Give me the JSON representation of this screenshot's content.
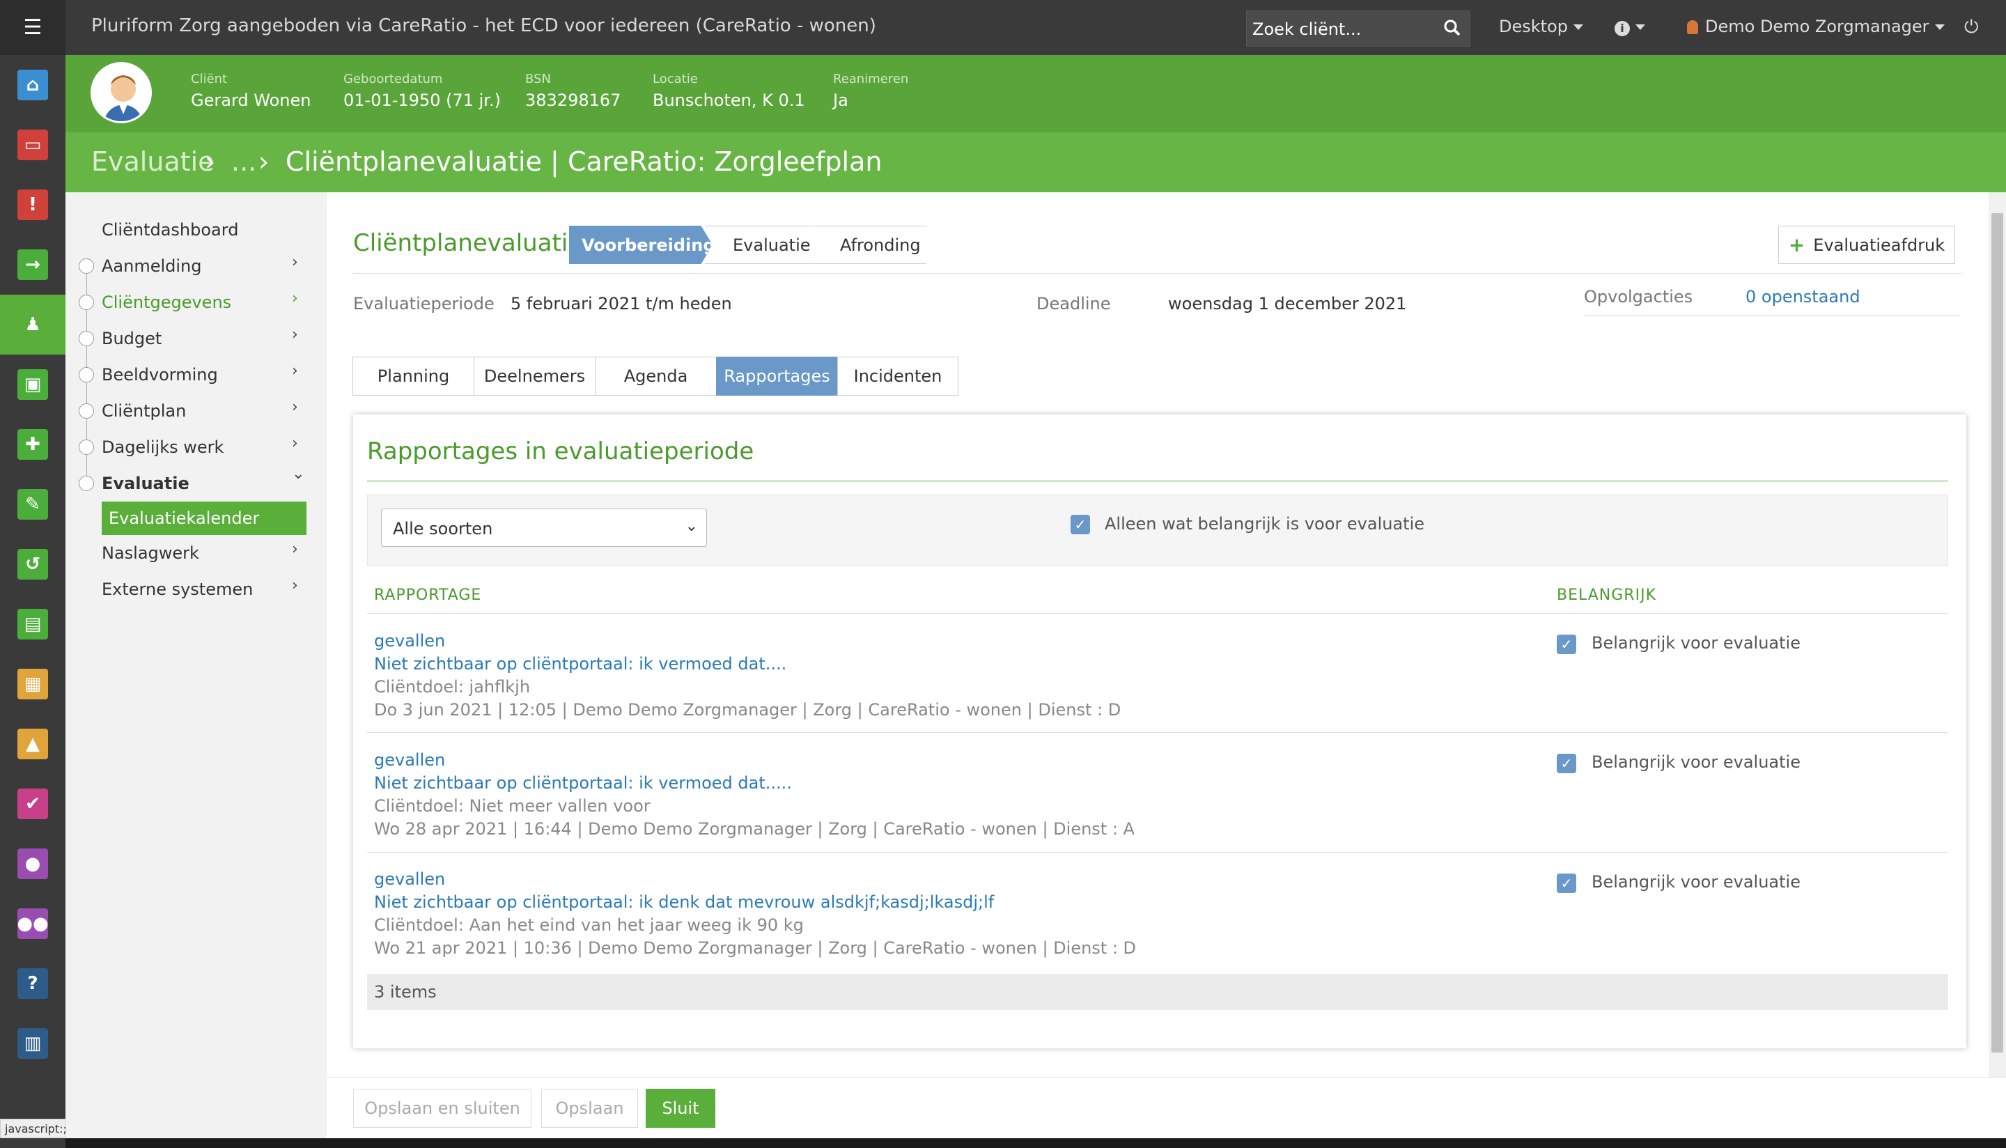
{
  "app": {
    "title": "Pluriform Zorg aangeboden via CareRatio - het ECD voor iedereen  (CareRatio - wonen)",
    "search_placeholder": "Zoek cliënt...",
    "desktop_label": "Desktop",
    "user_label": "Demo Demo Zorgmanager"
  },
  "client": {
    "fields": [
      {
        "label": "Cliënt",
        "value": "Gerard Wonen"
      },
      {
        "label": "Geboortedatum",
        "value": "01-01-1950 (71 jr.)"
      },
      {
        "label": "BSN",
        "value": "383298167"
      },
      {
        "label": "Locatie",
        "value": "Bunschoten, K 0.1"
      },
      {
        "label": "Reanimeren",
        "value": "Ja"
      }
    ]
  },
  "breadcrumb": {
    "root": "Evaluatie",
    "sep1": "›",
    "ellipsis": "...",
    "sep2": "›",
    "current": "Cliëntplanevaluatie | CareRatio: Zorgleefplan"
  },
  "sidebar": {
    "items": [
      {
        "label": "Cliëntdashboard"
      },
      {
        "label": "Aanmelding",
        "chevron": "›"
      },
      {
        "label": "Cliëntgegevens",
        "chevron": "›"
      },
      {
        "label": "Budget",
        "chevron": "›"
      },
      {
        "label": "Beeldvorming",
        "chevron": "›"
      },
      {
        "label": "Cliëntplan",
        "chevron": "›"
      },
      {
        "label": "Dagelijks werk",
        "chevron": "›"
      },
      {
        "label": "Evaluatie",
        "chevron": "⌄"
      },
      {
        "label": "Evaluatiekalender"
      },
      {
        "label": "Naslagwerk",
        "chevron": "›"
      },
      {
        "label": "Externe systemen",
        "chevron": "›"
      }
    ]
  },
  "wizard": {
    "title": "Cliëntplanevaluatie",
    "steps": [
      "Voorbereiding",
      "Evaluatie",
      "Afronding"
    ],
    "print_button": "Evaluatieafdruk"
  },
  "meta": {
    "period_label": "Evaluatieperiode",
    "period_value": "5 februari 2021 t/m heden",
    "deadline_label": "Deadline",
    "deadline_value": "woensdag 1 december 2021",
    "followup_label": "Opvolgacties",
    "followup_value": "0 openstaand"
  },
  "tabs": [
    "Planning",
    "Deelnemers",
    "Agenda",
    "Rapportages",
    "Incidenten"
  ],
  "reports": {
    "title": "Rapportages in evaluatieperiode",
    "filter_select": "Alle soorten",
    "filter_checkbox": "Alleen wat belangrijk is voor evaluatie",
    "col_report": "RAPPORTAGE",
    "col_important": "BELANGRIJK",
    "rows": [
      {
        "type": "gevallen",
        "text": "Niet zichtbaar op cliëntportaal: ik vermoed dat....",
        "goal": "Cliëntdoel: jahflkjh",
        "meta": "Do 3 jun 2021 | 12:05 | Demo Demo Zorgmanager | Zorg | CareRatio - wonen | Dienst : D",
        "important": "Belangrijk voor evaluatie"
      },
      {
        "type": "gevallen",
        "text": "Niet zichtbaar op cliëntportaal: ik vermoed dat.....",
        "goal": "Cliëntdoel: Niet meer vallen voor",
        "meta": "Wo 28 apr 2021 | 16:44 | Demo Demo Zorgmanager | Zorg | CareRatio - wonen | Dienst : A",
        "important": "Belangrijk voor evaluatie"
      },
      {
        "type": "gevallen",
        "text": "Niet zichtbaar op cliëntportaal: ik denk dat mevrouw alsdkjf;kasdj;lkasdj;lf",
        "goal": "Cliëntdoel: Aan het eind van het jaar weeg ik 90 kg",
        "meta": "Wo 21 apr 2021 | 10:36 | Demo Demo Zorgmanager | Zorg | CareRatio - wonen | Dienst : D",
        "important": "Belangrijk voor evaluatie"
      }
    ],
    "count": "3 items"
  },
  "footer": {
    "save_close": "Opslaan en sluiten",
    "save": "Opslaan",
    "close": "Sluit"
  },
  "statusbar": "javascript:;",
  "colors": {
    "green": "#5aae3a",
    "blue": "#6a98c8",
    "dark": "#3a3a3a"
  }
}
